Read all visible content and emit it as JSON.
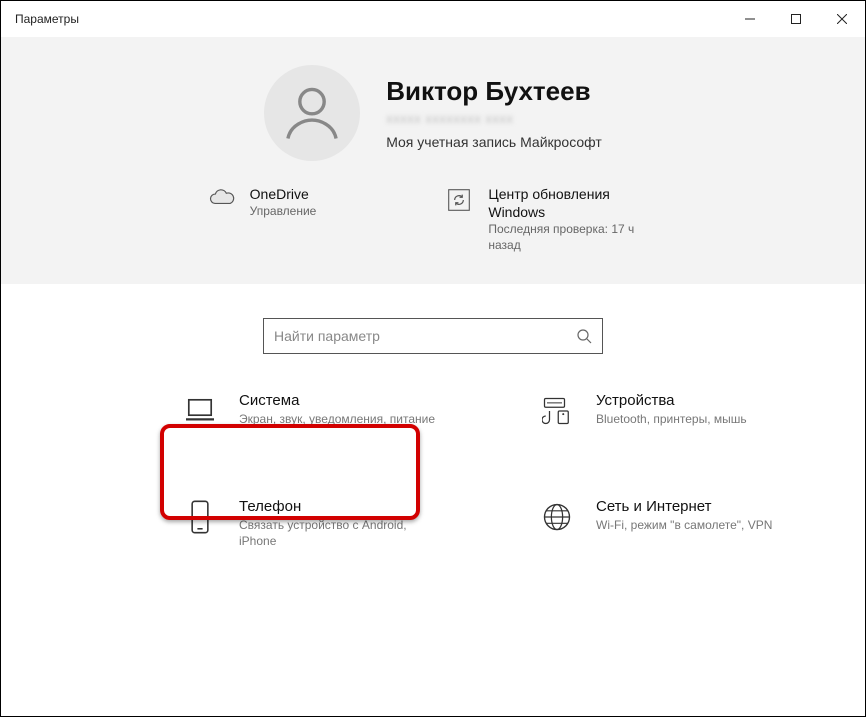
{
  "window": {
    "title": "Параметры"
  },
  "user": {
    "name": "Виктор Бухтеев",
    "email_masked": "xxxxx xxxxxxxx xxxx",
    "account_label": "Моя учетная запись Майкрософт"
  },
  "tiles": {
    "onedrive": {
      "title": "OneDrive",
      "sub": "Управление"
    },
    "update": {
      "title": "Центр обновления Windows",
      "sub": "Последняя проверка: 17 ч назад"
    }
  },
  "search": {
    "placeholder": "Найти параметр"
  },
  "categories": {
    "system": {
      "title": "Система",
      "desc": "Экран, звук, уведомления, питание"
    },
    "devices": {
      "title": "Устройства",
      "desc": "Bluetooth, принтеры, мышь"
    },
    "phone": {
      "title": "Телефон",
      "desc": "Связать устройство с Android, iPhone"
    },
    "network": {
      "title": "Сеть и Интернет",
      "desc": "Wi-Fi, режим \"в самолете\", VPN"
    }
  }
}
